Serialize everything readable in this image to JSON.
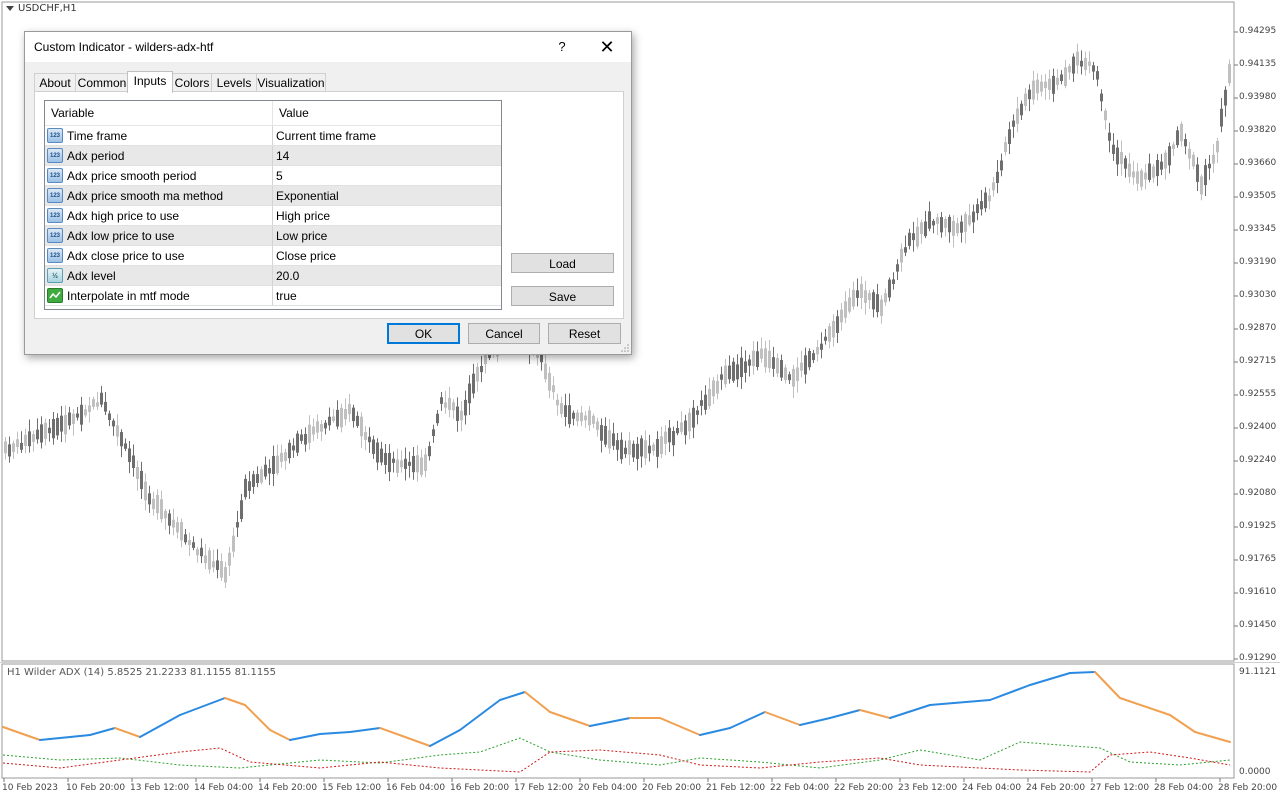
{
  "chart": {
    "symbol_title": "USDCHF,H1",
    "indicator_label": "H1 Wilder ADX (14) 5.8525 21.2233 81.1155 81.1155",
    "price_labels": [
      "0.94295",
      "0.94135",
      "0.93980",
      "0.93820",
      "0.93660",
      "0.93505",
      "0.93345",
      "0.93190",
      "0.93030",
      "0.92870",
      "0.92715",
      "0.92555",
      "0.92400",
      "0.92240",
      "0.92080",
      "0.91925",
      "0.91765",
      "0.91610",
      "0.91450",
      "0.91290"
    ],
    "indicator_scale_top": "91.1121",
    "indicator_scale_bottom": "0.0000",
    "time_labels": [
      "10 Feb 2023",
      "10 Feb 20:00",
      "13 Feb 12:00",
      "14 Feb 04:00",
      "14 Feb 20:00",
      "15 Feb 12:00",
      "16 Feb 04:00",
      "16 Feb 20:00",
      "17 Feb 12:00",
      "20 Feb 04:00",
      "20 Feb 20:00",
      "21 Feb 12:00",
      "22 Feb 04:00",
      "22 Feb 20:00",
      "23 Feb 12:00",
      "24 Feb 04:00",
      "24 Feb 20:00",
      "27 Feb 12:00",
      "28 Feb 04:00",
      "28 Feb 20:00"
    ],
    "colors": {
      "bull": "#c0c0c0",
      "bear": "#6e6e6e",
      "adx_up": "#2a8ae2",
      "adx_down": "#f0a050",
      "plus_di": "#2ea02e",
      "minus_di": "#cc1a1a"
    }
  },
  "dialog": {
    "title": "Custom Indicator - wilders-adx-htf",
    "help": "?",
    "close": "✕",
    "tabs": [
      {
        "label": "About"
      },
      {
        "label": "Common"
      },
      {
        "label": "Inputs"
      },
      {
        "label": "Colors"
      },
      {
        "label": "Levels"
      },
      {
        "label": "Visualization"
      }
    ],
    "active_tab": "Inputs",
    "grid": {
      "header_variable": "Variable",
      "header_value": "Value",
      "rows": [
        {
          "icon": "123",
          "variable": "Time frame",
          "value": "Current time frame"
        },
        {
          "icon": "123",
          "variable": "Adx period",
          "value": "14"
        },
        {
          "icon": "123",
          "variable": "Adx price smooth period",
          "value": "5"
        },
        {
          "icon": "123",
          "variable": "Adx price smooth ma method",
          "value": "Exponential"
        },
        {
          "icon": "123",
          "variable": "Adx high price to use",
          "value": "High price"
        },
        {
          "icon": "123",
          "variable": "Adx low price to use",
          "value": "Low price"
        },
        {
          "icon": "123",
          "variable": "Adx close price to use",
          "value": "Close price"
        },
        {
          "icon": "½",
          "variable": "Adx level",
          "value": "20.0"
        },
        {
          "icon": "",
          "variable": "Interpolate in mtf mode",
          "value": "true"
        }
      ]
    },
    "buttons": {
      "load": "Load",
      "save": "Save",
      "ok": "OK",
      "cancel": "Cancel",
      "reset": "Reset"
    }
  }
}
